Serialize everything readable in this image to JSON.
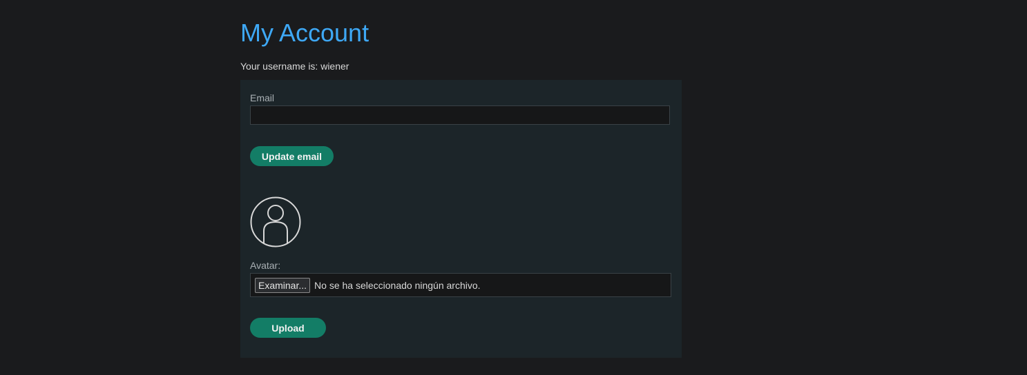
{
  "page": {
    "title": "My Account",
    "username_line": "Your username is: wiener"
  },
  "email_form": {
    "label": "Email",
    "value": "",
    "button_label": "Update email"
  },
  "avatar_form": {
    "avatar_icon": "user-avatar-icon",
    "label": "Avatar:",
    "file_button_label": "Examinar...",
    "file_status": "No se ha seleccionado ningún archivo.",
    "upload_button_label": "Upload"
  },
  "colors": {
    "background": "#1a1b1d",
    "panel": "#1c2529",
    "title": "#3ea8f5",
    "button": "#137d66"
  }
}
